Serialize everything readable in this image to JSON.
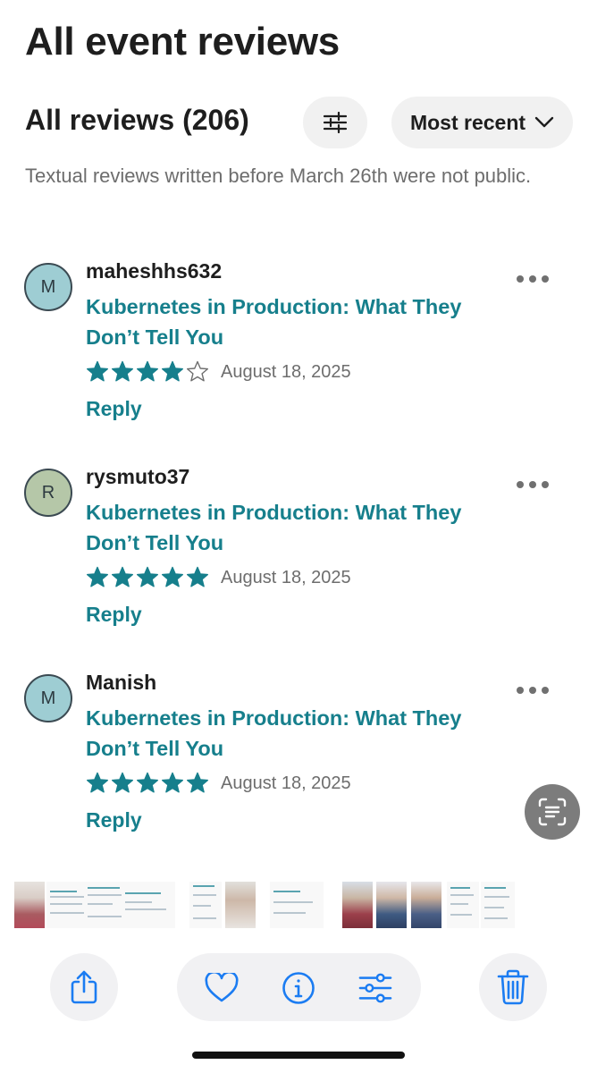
{
  "page": {
    "title": "All event reviews"
  },
  "reviews_header": {
    "count_label": "All reviews (206)",
    "filter_icon": "sliders-icon",
    "sort_label": "Most recent",
    "sort_icon": "chevron-down-icon"
  },
  "notice": "Textual reviews written before March 26th were not public.",
  "reviews": [
    {
      "initial": "M",
      "avatar_color": "#9ecdd3",
      "reviewer": "maheshhs632",
      "event": "Kubernetes in Production: What They Don’t Tell You",
      "rating": 4,
      "max_rating": 5,
      "date": "August 18, 2025",
      "reply_label": "Reply"
    },
    {
      "initial": "R",
      "avatar_color": "#b5c7a8",
      "reviewer": "rysmuto37",
      "event": "Kubernetes in Production: What They Don’t Tell You",
      "rating": 5,
      "max_rating": 5,
      "date": "August 18, 2025",
      "reply_label": "Reply"
    },
    {
      "initial": "M",
      "avatar_color": "#9ecdd3",
      "reviewer": "Manish",
      "event": "Kubernetes in Production: What They Don’t Tell You",
      "rating": 5,
      "max_rating": 5,
      "date": "August 18, 2025",
      "reply_label": "Reply"
    }
  ],
  "colors": {
    "accent": "#167f8c",
    "star": "#167f8c",
    "ios_blue": "#1b7cf2",
    "muted_text": "#6d6d6d"
  },
  "toolbar": {
    "share_icon": "share-icon",
    "favorite_icon": "heart-icon",
    "info_icon": "info-icon",
    "adjust_icon": "adjust-icon",
    "delete_icon": "trash-icon"
  },
  "overlay": {
    "scan_icon": "live-text-scan-icon"
  }
}
